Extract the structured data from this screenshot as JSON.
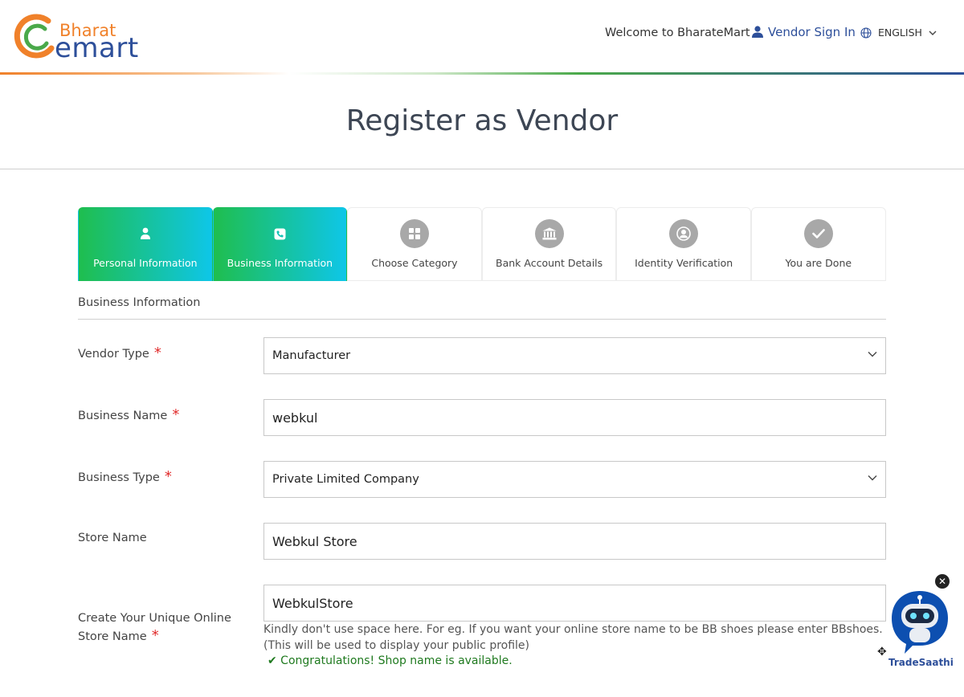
{
  "header": {
    "logo_top": "Bharat",
    "logo_bottom": "emart",
    "welcome": "Welcome to BharateMart",
    "vendor_signin": "Vendor Sign In",
    "language": "ENGLISH",
    "colors": {
      "orange": "#f0812a",
      "blue": "#2d4f9a",
      "green": "#4aa94a"
    }
  },
  "page": {
    "title": "Register as Vendor"
  },
  "steps": [
    {
      "label": "Personal Information",
      "icon": "user-icon",
      "active": true
    },
    {
      "label": "Business Information",
      "icon": "phone-icon",
      "active": true
    },
    {
      "label": "Choose Category",
      "icon": "grid-icon",
      "active": false
    },
    {
      "label": "Bank Account Details",
      "icon": "bank-icon",
      "active": false
    },
    {
      "label": "Identity Verification",
      "icon": "user-circle-icon",
      "active": false
    },
    {
      "label": "You are Done",
      "icon": "check-icon",
      "active": false
    }
  ],
  "section": {
    "title": "Business Information"
  },
  "form": {
    "vendor_type": {
      "label": "Vendor Type",
      "required": "*",
      "value": "Manufacturer"
    },
    "business_name": {
      "label": "Business Name",
      "required": "*",
      "value": "webkul"
    },
    "business_type": {
      "label": "Business Type",
      "required": "*",
      "value": "Private Limited Company"
    },
    "store_name": {
      "label": "Store Name",
      "value": "Webkul Store"
    },
    "online_store": {
      "label_line1": "Create Your Unique Online",
      "label_line2": "Store Name",
      "required": "*",
      "value": "WebkulStore",
      "hint": "Kindly don't use space here. For eg. If you want your online store name to be BB shoes please enter BBshoes. (This will be used to display your public profile)",
      "success": "✔ Congratulations! Shop name is available."
    }
  },
  "chatbot": {
    "name": "TradeSaathi",
    "close": "✕"
  }
}
